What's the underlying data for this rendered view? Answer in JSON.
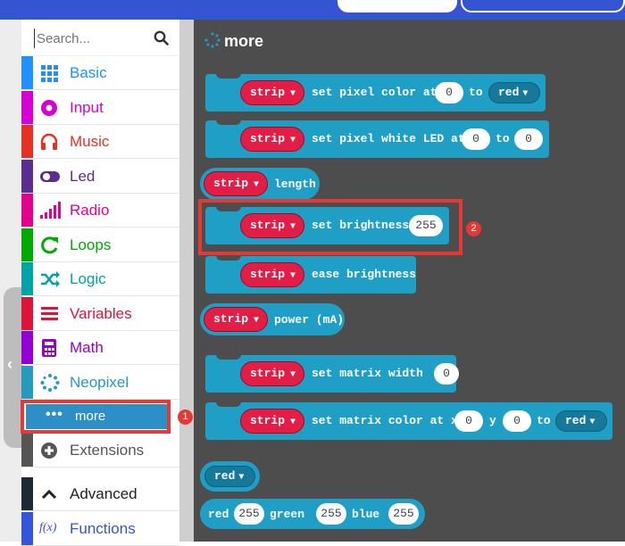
{
  "search": {
    "placeholder": "Search..."
  },
  "categories": [
    {
      "label": "Basic",
      "color": "#1e90ff",
      "icon": "grid-icon"
    },
    {
      "label": "Input",
      "color": "#d400d4",
      "icon": "circle-dot-icon"
    },
    {
      "label": "Music",
      "color": "#e63022",
      "icon": "headphones-icon"
    },
    {
      "label": "Led",
      "color": "#5c2d91",
      "icon": "toggle-icon"
    },
    {
      "label": "Radio",
      "color": "#e3008c",
      "icon": "signal-bars-icon"
    },
    {
      "label": "Loops",
      "color": "#00aa00",
      "icon": "refresh-icon"
    },
    {
      "label": "Logic",
      "color": "#00a4a6",
      "icon": "shuffle-icon"
    },
    {
      "label": "Variables",
      "color": "#dc143c",
      "icon": "list-icon"
    },
    {
      "label": "Math",
      "color": "#9400d3",
      "icon": "calculator-icon"
    },
    {
      "label": "Neopixel",
      "color": "#2699bf",
      "icon": "spinner-dots-icon"
    }
  ],
  "more": {
    "label": "more",
    "dots": "•••"
  },
  "extensions": {
    "label": "Extensions"
  },
  "advanced": {
    "label": "Advanced"
  },
  "functions": {
    "label": "Functions",
    "icon_text": "f(x)"
  },
  "badges": {
    "one": "1",
    "two": "2"
  },
  "workspace": {
    "title": "more"
  },
  "blocks": {
    "var_name": "strip",
    "b1": {
      "text": "set pixel color at",
      "num": "0",
      "to": "to",
      "dd": "red"
    },
    "b2": {
      "text": "set pixel white LED at",
      "num1": "0",
      "to": "to",
      "num2": "0"
    },
    "b3": {
      "text": "length"
    },
    "b4": {
      "text": "set brightness",
      "num": "255"
    },
    "b5": {
      "text": "ease brightness"
    },
    "b6": {
      "text": "power (mA)"
    },
    "b7": {
      "text": "set matrix width",
      "num": "0"
    },
    "b8": {
      "text": "set matrix color at x",
      "num1": "0",
      "y": "y",
      "num2": "0",
      "to": "to",
      "dd": "red"
    },
    "b9": {
      "dd": "red"
    },
    "b10": {
      "red": "red",
      "r": "255",
      "green": "green",
      "g": "255",
      "blue": "blue",
      "b": "255"
    }
  }
}
